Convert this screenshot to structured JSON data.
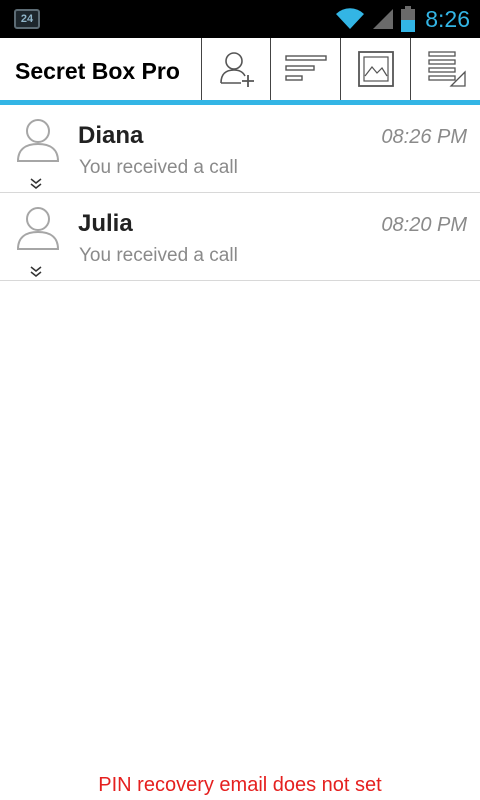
{
  "status_bar": {
    "notification_badge": "24",
    "time": "8:26",
    "icons": [
      "wifi-icon",
      "signal-icon",
      "battery-icon"
    ],
    "accent_color": "#33b5e5"
  },
  "action_bar": {
    "title": "Secret Box Pro",
    "actions": [
      {
        "name": "add-contact",
        "icon": "add-contact-icon"
      },
      {
        "name": "sort",
        "icon": "sort-icon"
      },
      {
        "name": "gallery",
        "icon": "image-icon"
      },
      {
        "name": "menu",
        "icon": "overflow-menu-icon"
      }
    ]
  },
  "contacts": [
    {
      "name": "Diana",
      "message": "You received a call",
      "time": "08:26 PM"
    },
    {
      "name": "Julia",
      "message": "You received a call",
      "time": "08:20 PM"
    }
  ],
  "footer": {
    "warning": "PIN recovery email does not set",
    "warning_color": "#e5201f"
  }
}
